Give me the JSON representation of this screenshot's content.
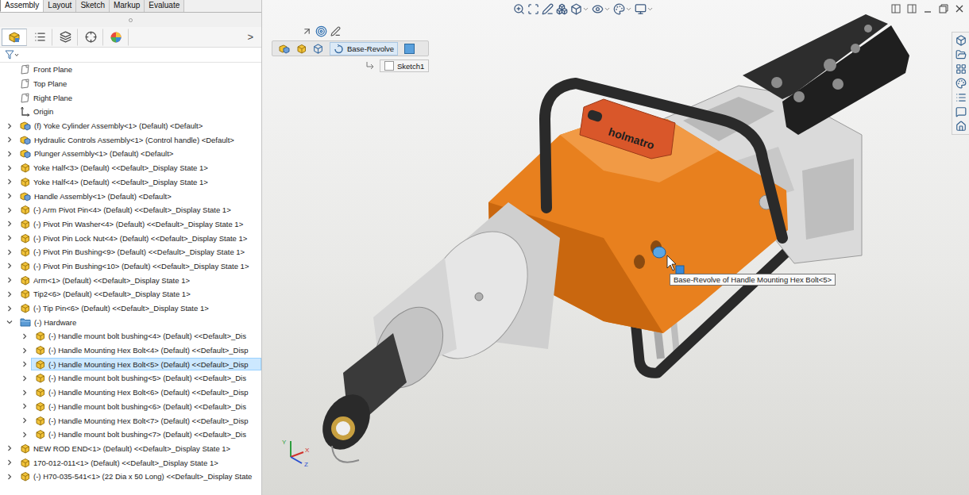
{
  "command_tabs": [
    {
      "label": "Assembly",
      "selected": true
    },
    {
      "label": "Layout",
      "selected": false
    },
    {
      "label": "Sketch",
      "selected": false
    },
    {
      "label": "Markup",
      "selected": false
    },
    {
      "label": "Evaluate",
      "selected": false
    }
  ],
  "manager_tabs": [
    {
      "kind": "feature",
      "selected": true
    },
    {
      "kind": "property",
      "selected": false
    },
    {
      "kind": "configuration",
      "selected": false
    },
    {
      "kind": "dimxpert",
      "selected": false
    },
    {
      "kind": "display",
      "selected": false
    }
  ],
  "manager_more": ">",
  "tree": [
    {
      "label": "Front Plane",
      "kind": "plane",
      "expandable": false,
      "expanded": false,
      "selected": false
    },
    {
      "label": "Top Plane",
      "kind": "plane",
      "expandable": false,
      "expanded": false,
      "selected": false
    },
    {
      "label": "Right Plane",
      "kind": "plane",
      "expandable": false,
      "expanded": false,
      "selected": false
    },
    {
      "label": "Origin",
      "kind": "origin",
      "expandable": false,
      "expanded": false,
      "selected": false
    },
    {
      "label": "(f) Yoke Cylinder Assembly<1> (Default) <Default>",
      "kind": "assembly",
      "expandable": true,
      "expanded": false,
      "selected": false
    },
    {
      "label": "Hydraulic Controls Assembly<1> (Control handle) <Default>",
      "kind": "assembly",
      "expandable": true,
      "expanded": false,
      "selected": false
    },
    {
      "label": "Plunger Assembly<1> (Default) <Default>",
      "kind": "assembly",
      "expandable": true,
      "expanded": false,
      "selected": false
    },
    {
      "label": "Yoke Half<3> (Default) <<Default>_Display State 1>",
      "kind": "part",
      "expandable": true,
      "expanded": false,
      "selected": false
    },
    {
      "label": "Yoke Half<4> (Default) <<Default>_Display State 1>",
      "kind": "part",
      "expandable": true,
      "expanded": false,
      "selected": false
    },
    {
      "label": "Handle Assembly<1> (Default) <Default>",
      "kind": "assembly",
      "expandable": true,
      "expanded": false,
      "selected": false
    },
    {
      "label": "(-) Arm Pivot Pin<4> (Default) <<Default>_Display State 1>",
      "kind": "part",
      "expandable": true,
      "expanded": false,
      "selected": false
    },
    {
      "label": "(-) Pivot Pin Washer<4> (Default) <<Default>_Display State 1>",
      "kind": "part",
      "expandable": true,
      "expanded": false,
      "selected": false
    },
    {
      "label": "(-) Pivot Pin Lock Nut<4> (Default) <<Default>_Display State 1>",
      "kind": "part",
      "expandable": true,
      "expanded": false,
      "selected": false
    },
    {
      "label": "(-) Pivot Pin Bushing<9> (Default) <<Default>_Display State 1>",
      "kind": "part",
      "expandable": true,
      "expanded": false,
      "selected": false
    },
    {
      "label": "(-) Pivot Pin Bushing<10> (Default) <<Default>_Display State 1>",
      "kind": "part",
      "expandable": true,
      "expanded": false,
      "selected": false
    },
    {
      "label": "Arm<1> (Default) <<Default>_Display State 1>",
      "kind": "part",
      "expandable": true,
      "expanded": false,
      "selected": false
    },
    {
      "label": "Tip2<6> (Default) <<Default>_Display State 1>",
      "kind": "part",
      "expandable": true,
      "expanded": false,
      "selected": false
    },
    {
      "label": "(-) Tip Pin<6> (Default) <<Default>_Display State 1>",
      "kind": "part",
      "expandable": true,
      "expanded": false,
      "selected": false
    },
    {
      "label": "(-) Hardware",
      "kind": "folder",
      "expandable": true,
      "expanded": true,
      "selected": false,
      "children": [
        {
          "label": "(-) Handle mount bolt bushing<4> (Default) <<Default>_Dis",
          "kind": "part",
          "expandable": true,
          "expanded": false,
          "selected": false
        },
        {
          "label": "(-) Handle Mounting Hex Bolt<4> (Default) <<Default>_Disp",
          "kind": "part",
          "expandable": true,
          "expanded": false,
          "selected": false
        },
        {
          "label": "(-) Handle Mounting Hex Bolt<5> (Default) <<Default>_Disp",
          "kind": "part",
          "expandable": true,
          "expanded": false,
          "selected": true
        },
        {
          "label": "(-) Handle mount bolt bushing<5> (Default) <<Default>_Dis",
          "kind": "part",
          "expandable": true,
          "expanded": false,
          "selected": false
        },
        {
          "label": "(-) Handle Mounting Hex Bolt<6> (Default) <<Default>_Disp",
          "kind": "part",
          "expandable": true,
          "expanded": false,
          "selected": false
        },
        {
          "label": "(-) Handle mount bolt bushing<6> (Default) <<Default>_Dis",
          "kind": "part",
          "expandable": true,
          "expanded": false,
          "selected": false
        },
        {
          "label": "(-) Handle Mounting Hex Bolt<7> (Default) <<Default>_Disp",
          "kind": "part",
          "expandable": true,
          "expanded": false,
          "selected": false
        },
        {
          "label": "(-) Handle mount bolt bushing<7> (Default) <<Default>_Dis",
          "kind": "part",
          "expandable": true,
          "expanded": false,
          "selected": false
        }
      ]
    },
    {
      "label": "NEW ROD END<1> (Default) <<Default>_Display State 1>",
      "kind": "part",
      "expandable": true,
      "expanded": false,
      "selected": false
    },
    {
      "label": "170-012-011<1> (Default) <<Default>_Display State 1>",
      "kind": "part",
      "expandable": true,
      "expanded": false,
      "selected": false
    },
    {
      "label": "(-) H70-035-541<1> (22 Dia x 50 Long) <<Default>_Display State",
      "kind": "part",
      "expandable": true,
      "expanded": false,
      "selected": false
    }
  ],
  "breadcrumb": {
    "current": "Base-Revolve",
    "child": "Sketch1"
  },
  "model": {
    "brand": "holmatro"
  },
  "tooltip": "Base-Revolve of Handle Mounting Hex Bolt<5>",
  "triad": {
    "x": "X",
    "y": "Y",
    "z": "Z"
  }
}
